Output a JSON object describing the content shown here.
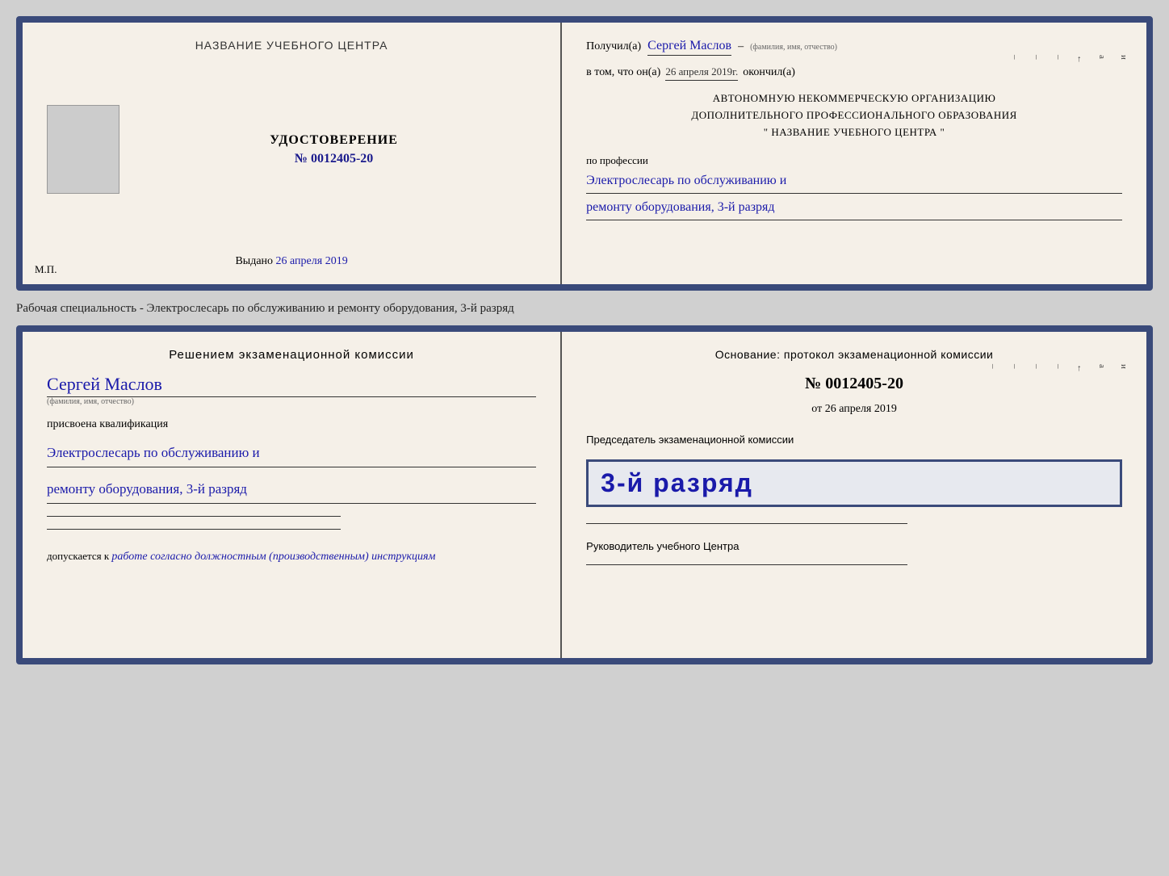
{
  "top_certificate": {
    "left": {
      "org_name": "НАЗВАНИЕ УЧЕБНОГО ЦЕНТРА",
      "photo_alt": "фото",
      "cert_title": "УДОСТОВЕРЕНИЕ",
      "cert_number_label": "№",
      "cert_number": "0012405-20",
      "issued_label": "Выдано",
      "issued_date": "26 апреля 2019",
      "mp_label": "М.П."
    },
    "right": {
      "received_label": "Получил(а)",
      "recipient_name": "Сергей Маслов",
      "fio_subtitle": "(фамилия, имя, отчество)",
      "dash": "–",
      "in_that_label": "в том, что он(а)",
      "completed_date": "26 апреля 2019г.",
      "completed_label": "окончил(а)",
      "org_line1": "АВТОНОМНУЮ НЕКОММЕРЧЕСКУЮ ОРГАНИЗАЦИЮ",
      "org_line2": "ДОПОЛНИТЕЛЬНОГО ПРОФЕССИОНАЛЬНОГО ОБРАЗОВАНИЯ",
      "org_name_quoted": "\"  НАЗВАНИЕ УЧЕБНОГО ЦЕНТРА  \"",
      "profession_label": "по профессии",
      "profession_line1": "Электрослесарь по обслуживанию и",
      "profession_line2": "ремонту оборудования, 3-й разряд",
      "right_edge_chars": [
        "и",
        "а",
        "←",
        "–",
        "–",
        "–",
        "–"
      ]
    }
  },
  "separator": {
    "text": "Рабочая специальность - Электрослесарь по обслуживанию и ремонту оборудования, 3-й разряд"
  },
  "bottom_certificate": {
    "left": {
      "decision_title": "Решением  экзаменационной  комиссии",
      "person_name": "Сергей Маслов",
      "fio_subtitle": "(фамилия, имя, отчество)",
      "assigned_label": "присвоена квалификация",
      "qualification_line1": "Электрослесарь по обслуживанию и",
      "qualification_line2": "ремонту оборудования, 3-й разряд",
      "allowed_label": "допускается к",
      "allowed_text": "работе согласно должностным (производственным) инструкциям"
    },
    "right": {
      "basis_label": "Основание: протокол экзаменационной  комиссии",
      "number_prefix": "№",
      "protocol_number": "0012405-20",
      "date_prefix": "от",
      "protocol_date": "26 апреля 2019",
      "chairman_label": "Председатель экзаменационной комиссии",
      "stamp_text": "3-й разряд",
      "director_label": "Руководитель учебного Центра",
      "right_edge_chars": [
        "и",
        "а",
        "←",
        "–",
        "–",
        "–",
        "–"
      ]
    }
  }
}
